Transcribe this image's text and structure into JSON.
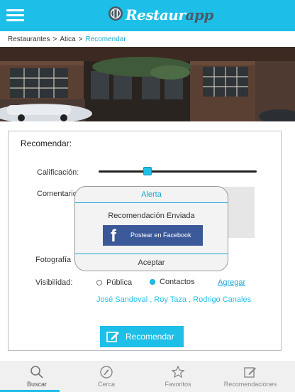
{
  "app": {
    "name_main": "Restaur",
    "name_accent": "app"
  },
  "colors": {
    "accent": "#1dbfe8",
    "facebook": "#3b5998",
    "link": "#1aa6d4"
  },
  "breadcrumb": {
    "items": [
      "Restaurantes",
      "Atica"
    ],
    "current": "Recomendar",
    "separator": ">"
  },
  "form": {
    "title": "Recomendar:",
    "rating_label": "Calificación:",
    "rating_value": 0.31,
    "comment_label": "Comentario",
    "photo_label": "Fotografía",
    "visibility_label": "Visibilidad:",
    "visibility_options": [
      {
        "label": "Pública",
        "selected": false
      },
      {
        "label": "Contactos",
        "selected": true
      }
    ],
    "add_link": "Agregar",
    "contacts": "José Sandoval , Roy Taza , Rodrigo Canales",
    "submit_label": "Recomendar"
  },
  "modal": {
    "title": "Alerta",
    "message": "Recomendación Enviada",
    "facebook_button": "Postear en Facebook",
    "accept_label": "Aceptar"
  },
  "tabs": [
    {
      "label": "Buscar",
      "icon": "search-icon",
      "active": true
    },
    {
      "label": "Cerca",
      "icon": "compass-icon",
      "active": false
    },
    {
      "label": "Favoritos",
      "icon": "star-icon",
      "active": false
    },
    {
      "label": "Recomendaciones",
      "icon": "edit-icon",
      "active": false
    }
  ]
}
